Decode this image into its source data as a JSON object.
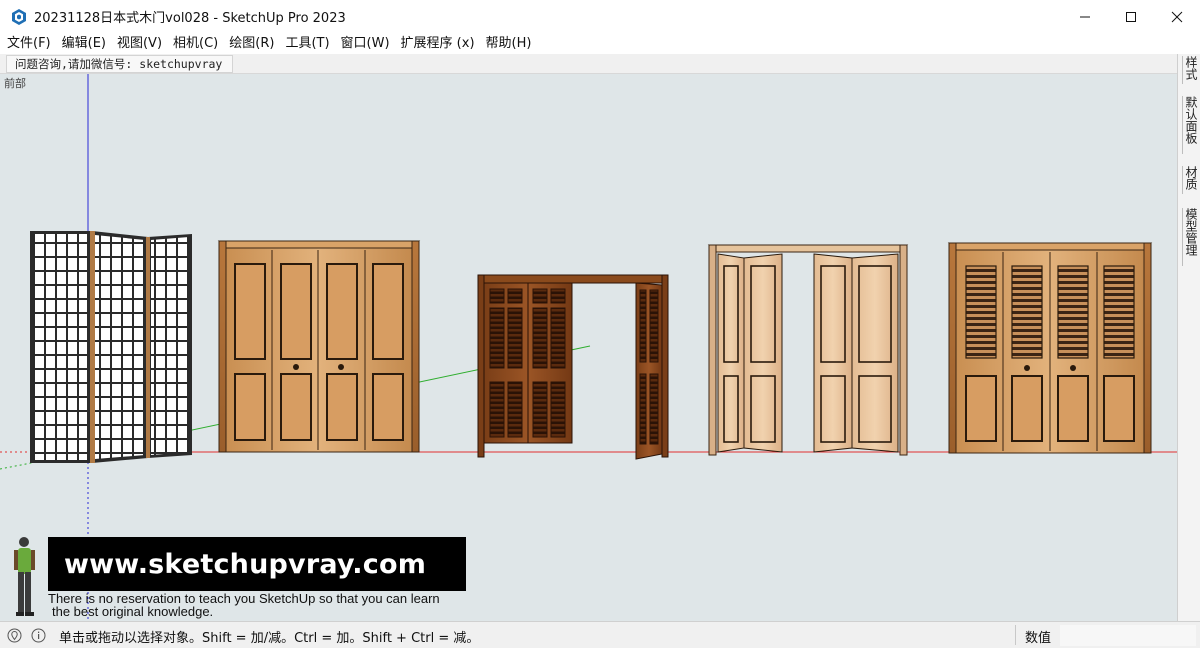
{
  "window": {
    "title": "20231128日本式木门vol028 - SketchUp Pro 2023",
    "controls": [
      "minimize",
      "maximize",
      "close"
    ]
  },
  "menu": [
    "文件(F)",
    "编辑(E)",
    "视图(V)",
    "相机(C)",
    "绘图(R)",
    "工具(T)",
    "窗口(W)",
    "扩展程序 (x)",
    "帮助(H)"
  ],
  "toolbar": {
    "note": "问题咨询,请加微信号: sketchupvray"
  },
  "viewport": {
    "view_name": "前部",
    "background": "#dfe6e8",
    "axes": {
      "red": "#e03030",
      "green": "#2fae2f",
      "blue": "#2a2ad6"
    },
    "models": [
      "shoji-screen",
      "four-panel-wood-door",
      "carved-bifold-door",
      "light-wood-bifold-door",
      "louvered-bifold-door"
    ]
  },
  "tray": {
    "tabs": [
      "样式",
      "默认面板",
      "材质",
      "模型管理"
    ]
  },
  "overlay": {
    "url": "www.sketchupvray.com",
    "tagline_1": "There is no reservation to teach you SketchUp so that you can learn",
    "tagline_2": "the best original knowledge."
  },
  "statusbar": {
    "hint": "单击或拖动以选择对象。Shift = 加/减。Ctrl = 加。Shift + Ctrl = 减。",
    "measurements_label": "数值",
    "measurements_value": ""
  }
}
